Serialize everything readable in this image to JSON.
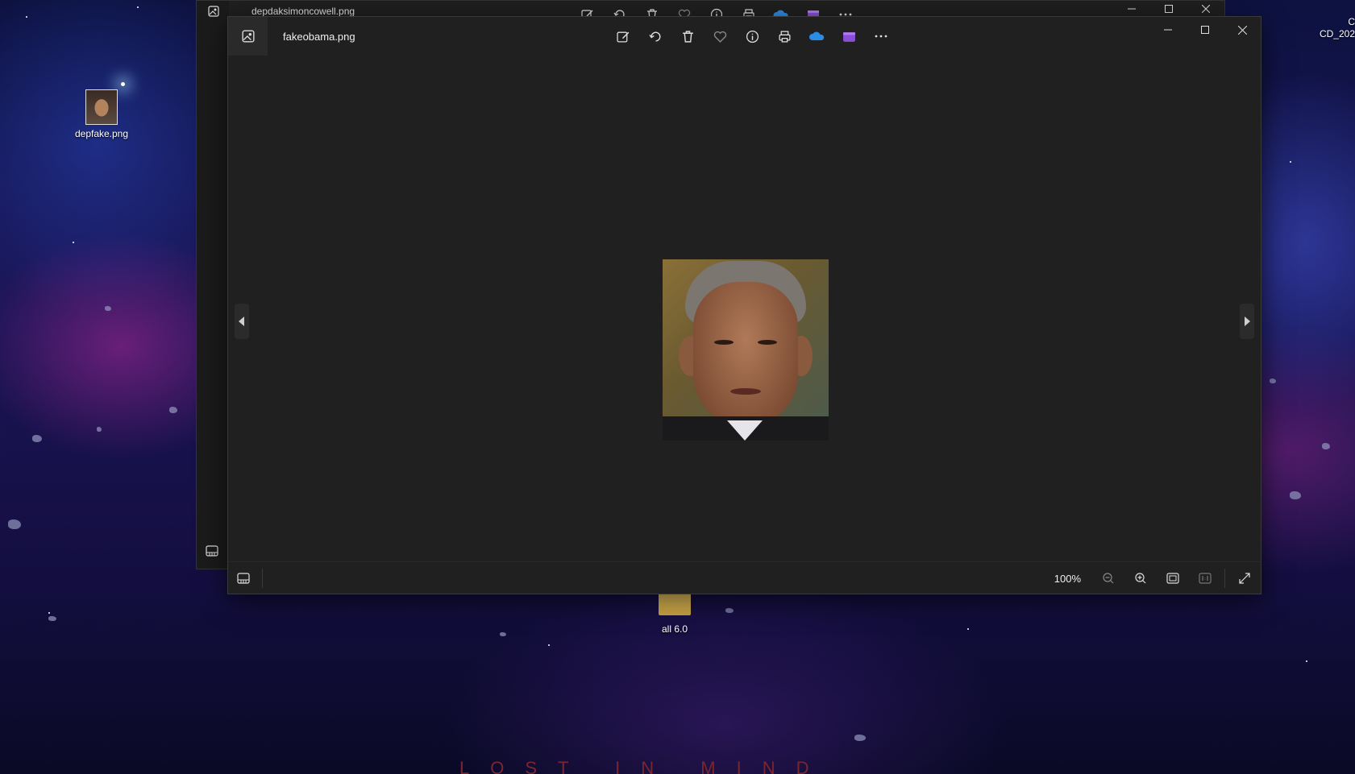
{
  "desktop": {
    "icons": [
      {
        "label": "depfake.png"
      },
      {
        "label": "all 6.0"
      }
    ],
    "corner_text_line1": "C",
    "corner_text_line2": "CD_202",
    "brand_text": "LOST IN MIND"
  },
  "back_window": {
    "title": "depdaksimoncowell.png"
  },
  "window": {
    "title": "fakeobama.png",
    "toolbar_icons": [
      "edit-image-icon",
      "rotate-icon",
      "delete-icon",
      "favorite-icon",
      "info-icon",
      "print-icon",
      "onedrive-icon",
      "clipchamp-icon",
      "more-icon"
    ],
    "zoom_level": "100%",
    "colors": {
      "window_bg": "#202020",
      "onedrive": "#2b8ce6",
      "clipchamp": "#8a4fd8"
    }
  }
}
